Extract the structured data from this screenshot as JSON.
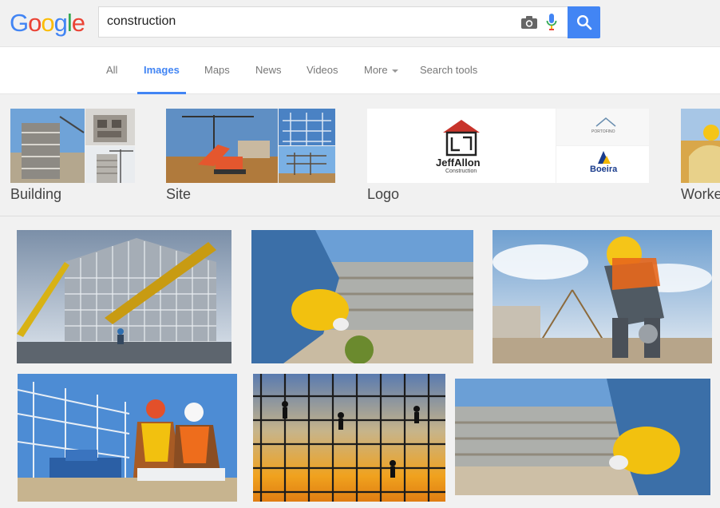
{
  "logo": {
    "letters": [
      "G",
      "o",
      "o",
      "g",
      "l",
      "e"
    ],
    "colors": [
      "#4285f4",
      "#ea4335",
      "#fbbc05",
      "#4285f4",
      "#34a853",
      "#ea4335"
    ]
  },
  "search": {
    "query": "construction"
  },
  "tabs": [
    {
      "label": "All",
      "active": false
    },
    {
      "label": "Images",
      "active": true
    },
    {
      "label": "Maps",
      "active": false
    },
    {
      "label": "News",
      "active": false
    },
    {
      "label": "Videos",
      "active": false
    },
    {
      "label": "More",
      "active": false
    },
    {
      "label": "Search tools",
      "active": false
    }
  ],
  "related": [
    {
      "label": "Building"
    },
    {
      "label": "Site"
    },
    {
      "label": "Logo",
      "logo_text": "JeffAllon",
      "logo_sub": "Construction",
      "logo2_text": "Boeira",
      "logo3_text": "PORTOFINO"
    },
    {
      "label": "Worke"
    }
  ],
  "colors": {
    "accent": "#4285f4",
    "sky": "#7fb3e6",
    "hardhat": "#f5c518",
    "orange": "#e8671b"
  }
}
